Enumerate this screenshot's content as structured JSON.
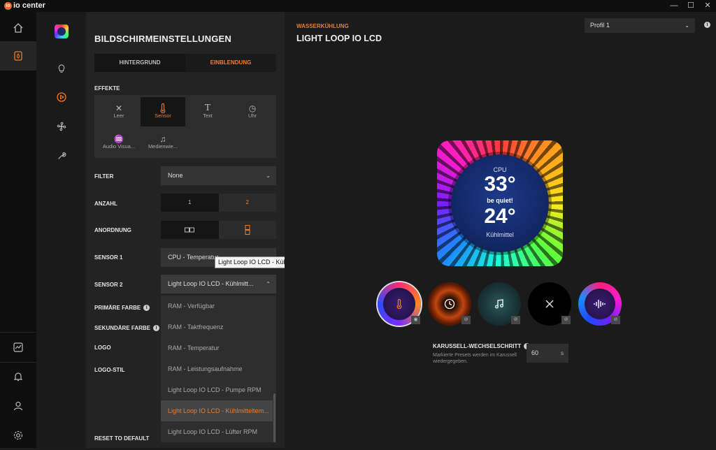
{
  "app": {
    "name": "io center",
    "minimize": "—",
    "maximize": "☐",
    "close": "✕"
  },
  "rail": {
    "items": [
      "home-icon",
      "device-icon",
      "monitoring-icon",
      "bell-icon",
      "user-icon",
      "settings-icon"
    ]
  },
  "subnav": {
    "items": [
      "lcd-thumbnail-icon",
      "bulb-icon",
      "display-icon",
      "fan-icon",
      "wrench-icon"
    ]
  },
  "panel": {
    "title": "BILDSCHIRMEINSTELLUNGEN",
    "tabs": [
      {
        "label": "HINTERGRUND"
      },
      {
        "label": "EINBLENDUNG"
      }
    ],
    "effects_label": "EFFEKTE",
    "effects": [
      {
        "label": "Leer",
        "icon": "✕"
      },
      {
        "label": "Sensor",
        "icon": "🌡"
      },
      {
        "label": "Text",
        "icon": "T"
      },
      {
        "label": "Uhr",
        "icon": "◷"
      },
      {
        "label": "Audio Visua...",
        "icon": "♒"
      },
      {
        "label": "Medienwie...",
        "icon": "♫"
      }
    ],
    "filter_label": "FILTER",
    "filter_value": "None",
    "anzahl_label": "ANZAHL",
    "anzahl_options": [
      "1",
      "2"
    ],
    "anordnung_label": "ANORDNUNG",
    "sensor1_label": "SENSOR 1",
    "sensor1_value": "CPU - Temperatur",
    "sensor2_label": "SENSOR 2",
    "sensor2_value": "Light Loop IO LCD - Kühlmitt...",
    "primary_label": "PRIMÄRE FARBE",
    "secondary_label": "SEKUNDÄRE FARBE",
    "logo_label": "LOGO",
    "logo_style_label": "LOGO-STIL",
    "reset_label": "RESET TO DEFAULT",
    "dropdown_items": [
      "RAM - Verfügbar",
      "RAM - Taktfrequenz",
      "RAM - Temperatur",
      "RAM - Leistungsaufnahme",
      "Light Loop IO LCD - Pumpe RPM",
      "Light Loop IO LCD - Kühlmitteltem...",
      "Light Loop IO LCD - Lüfter RPM"
    ],
    "tooltip": "Light Loop IO LCD - Kühlmitteltemperatur"
  },
  "main": {
    "breadcrumb": "WASSERKÜHLUNG",
    "title": "LIGHT LOOP IO LCD",
    "profile": "Profil 1",
    "lcd": {
      "top_label": "CPU",
      "top_value": "33°",
      "brand": "be quiet!",
      "bottom_value": "24°",
      "bottom_label": "Kühlmittel"
    },
    "presets": [
      "thermometer-icon",
      "clock-icon",
      "music-icon",
      "close-icon",
      "audio-wave-icon"
    ],
    "carousel_label": "KARUSSELL-WECHSELSCHRITT",
    "carousel_desc": "Markierte Presets werden im Karussell wiedergegeben.",
    "carousel_value": "60",
    "carousel_unit": "s"
  },
  "colors": {
    "accent": "#ee7e2e"
  }
}
